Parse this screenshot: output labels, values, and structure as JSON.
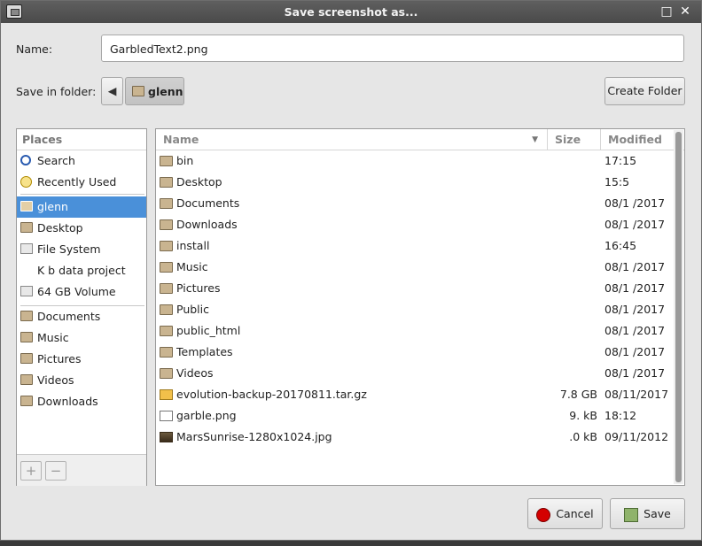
{
  "window": {
    "title": "Save screenshot as..."
  },
  "name_field": {
    "label": "Name:",
    "value": "GarbledText2.png"
  },
  "folder": {
    "label": "Save in folder:",
    "current": "glenn",
    "create_label": "Create Folder"
  },
  "places": {
    "header": "Places",
    "items": [
      {
        "label": "Search",
        "icon": "search-icon"
      },
      {
        "label": "Recently Used",
        "icon": "clock-icon"
      },
      {
        "label": "glenn",
        "icon": "home-folder-icon",
        "selected": true
      },
      {
        "label": "Desktop",
        "icon": "desktop-folder-icon"
      },
      {
        "label": "File System",
        "icon": "drive-icon"
      },
      {
        "label": "K b data project",
        "icon": ""
      },
      {
        "label": "64 GB Volume",
        "icon": "drive-icon"
      },
      {
        "label": "Documents",
        "icon": "folder-icon"
      },
      {
        "label": "Music",
        "icon": "folder-icon"
      },
      {
        "label": "Pictures",
        "icon": "folder-icon"
      },
      {
        "label": "Videos",
        "icon": "folder-icon"
      },
      {
        "label": "Downloads",
        "icon": "folder-icon"
      }
    ],
    "add_label": "+",
    "remove_label": "−"
  },
  "files": {
    "columns": {
      "name": "Name",
      "size": "Size",
      "modified": "Modified"
    },
    "rows": [
      {
        "name": "bin",
        "size": "",
        "modified": "17:15"
      },
      {
        "name": "Desktop",
        "size": "",
        "modified": "15:5"
      },
      {
        "name": "Documents",
        "size": "",
        "modified": "08/1 /2017"
      },
      {
        "name": "Downloads",
        "size": "",
        "modified": "08/1 /2017"
      },
      {
        "name": "install",
        "size": "",
        "modified": "16:45"
      },
      {
        "name": "Music",
        "size": "",
        "modified": "08/1 /2017"
      },
      {
        "name": "Pictures",
        "size": "",
        "modified": "08/1 /2017"
      },
      {
        "name": "Public",
        "size": "",
        "modified": "08/1 /2017"
      },
      {
        "name": "public_html",
        "size": "",
        "modified": "08/1 /2017"
      },
      {
        "name": "Templates",
        "size": "",
        "modified": "08/1 /2017"
      },
      {
        "name": "Videos",
        "size": "",
        "modified": "08/1 /2017"
      },
      {
        "name": "evolution-backup-20170811.tar.gz",
        "size": "7.8 GB",
        "modified": "08/11/2017"
      },
      {
        "name": "garble.png",
        "size": "9. kB",
        "modified": "18:12"
      },
      {
        "name": "MarsSunrise-1280x1024.jpg",
        "size": ".0 kB",
        "modified": "09/11/2012"
      }
    ]
  },
  "buttons": {
    "cancel": "Cancel",
    "save": "Save"
  }
}
